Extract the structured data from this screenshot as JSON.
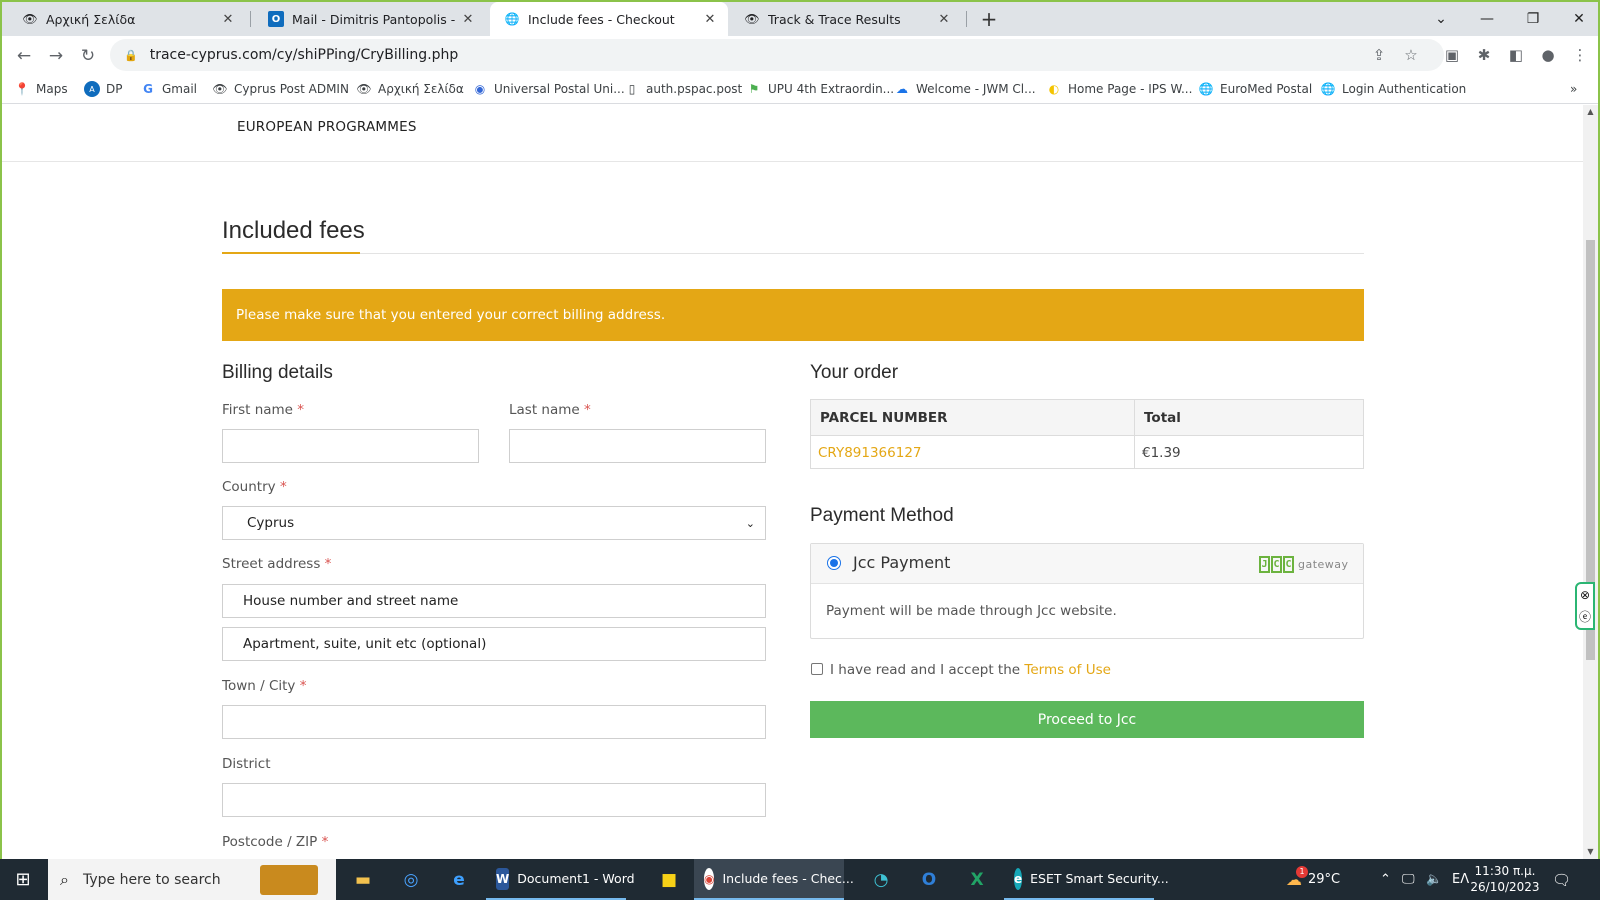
{
  "browser": {
    "tabs": [
      {
        "title": "Αρχική Σελίδα",
        "icon": "eye-favicon"
      },
      {
        "title": "Mail - Dimitris Pantopolis - Outlo",
        "icon": "outlook-favicon"
      },
      {
        "title": "Include fees - Checkout",
        "icon": "globe-favicon"
      },
      {
        "title": "Track & Trace Results",
        "icon": "eye-favicon"
      }
    ],
    "url": "trace-cyprus.com/cy/shiPPing/CryBilling.php",
    "bookmarks": [
      {
        "label": "Maps"
      },
      {
        "label": "DP"
      },
      {
        "label": "Gmail"
      },
      {
        "label": "Cyprus Post ADMIN"
      },
      {
        "label": "Αρχική Σελίδα"
      },
      {
        "label": "Universal Postal Uni..."
      },
      {
        "label": "auth.pspac.post"
      },
      {
        "label": "UPU 4th Extraordin..."
      },
      {
        "label": "Welcome - JWM Cl..."
      },
      {
        "label": "Home Page - IPS W..."
      },
      {
        "label": "EuroMed Postal"
      },
      {
        "label": "Login Authentication"
      }
    ]
  },
  "page": {
    "nav_item": "EUROPEAN PROGRAMMES",
    "heading": "Included fees",
    "alert": "Please make sure that you entered your correct billing address.",
    "billing": {
      "title": "Billing details",
      "first_name_label": "First name",
      "last_name_label": "Last name",
      "country_label": "Country",
      "country_value": "Cyprus",
      "street_label": "Street address",
      "street1_placeholder": "House number and street name",
      "street2_placeholder": "Apartment, suite, unit etc (optional)",
      "town_label": "Town / City",
      "district_label": "District",
      "postcode_label": "Postcode / ZIP",
      "required_mark": "*"
    },
    "order": {
      "title": "Your order",
      "col_parcel": "PARCEL NUMBER",
      "col_total": "Total",
      "parcel_number": "CRY891366127",
      "total": "€1.39"
    },
    "payment": {
      "title": "Payment Method",
      "method_label": "Jcc Payment",
      "logo_letters": [
        "J",
        "C",
        "C"
      ],
      "logo_word": "gateway",
      "description": "Payment will be made through Jcc website.",
      "accept_text": "I have read and I accept the",
      "terms_link": "Terms of Use",
      "proceed_label": "Proceed to Jcc"
    }
  },
  "taskbar": {
    "search_placeholder": "Type here to search",
    "apps": [
      {
        "label": "Document1 - Word",
        "icon": "word-icon"
      },
      {
        "label": "Include fees - Chec...",
        "icon": "chrome-icon"
      },
      {
        "label": "ESET Smart Security...",
        "icon": "eset-icon"
      }
    ],
    "temperature": "29°C",
    "language": "ΕΛ",
    "time": "11:30 π.μ.",
    "date": "26/10/2023",
    "notification_count": "1"
  },
  "colors": {
    "accent_orange": "#e4a715",
    "proceed_green": "#5cb85c",
    "jcc_green": "#6cb33f"
  }
}
